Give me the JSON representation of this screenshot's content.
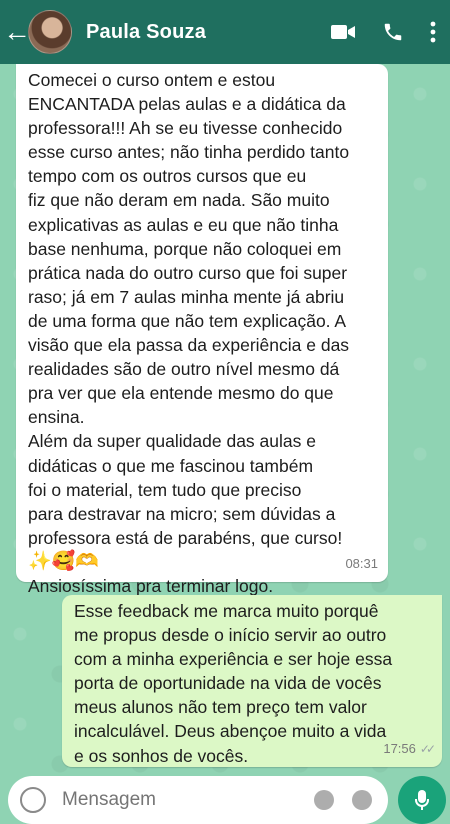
{
  "header": {
    "back_icon": "arrow-left-icon",
    "contact_name": "Paula Souza",
    "icons": [
      "video-call-icon",
      "phone-icon",
      "more-vertical-icon"
    ],
    "background_color": "#1f6f5f"
  },
  "chat": {
    "incoming": {
      "lines": [
        "Comecei o curso ontem e estou",
        "ENCANTADA pelas aulas e a didática da",
        "professora!!! Ah se eu tivesse conhecido",
        "esse curso antes; não tinha perdido tanto",
        "tempo com os outros cursos que eu",
        "fiz que não deram em nada. São muito",
        "explicativas as aulas e eu que não tinha",
        "base nenhuma, porque não coloquei em",
        "prática nada do outro curso que foi super",
        "raso; já em 7 aulas minha mente já abriu",
        "de uma forma que não tem explicação. A",
        "visão que ela passa da experiência e das",
        "realidades são de outro nível mesmo dá",
        "pra ver que ela entende mesmo do que",
        "ensina.",
        "Além da super qualidade das aulas e",
        "didáticas o que me fascinou também",
        "foi o material, tem tudo que preciso",
        "para destravar na micro; sem dúvidas a",
        "professora está de parabéns, que curso!"
      ],
      "emojis": "✨🥰🫶",
      "last_line": "Ansiosíssima pra terminar logo.",
      "time": "08:31",
      "bubble_color": "#ffffff"
    },
    "outgoing": {
      "lines": [
        "Esse feedback me marca muito porquê",
        "me propus desde o início servir ao outro",
        "com a minha experiência e ser hoje essa",
        "porta de oportunidade na vida de vocês",
        "meus alunos não tem preço tem valor",
        "incalculável. Deus abençoe muito a vida",
        "e os sonhos de vocês."
      ],
      "time": "17:56",
      "status_icon": "double-check-icon",
      "bubble_color": "#dcf8c6"
    }
  },
  "input_bar": {
    "placeholder": "Mensagem",
    "icons": [
      "emoji-icon",
      "attach-icon",
      "camera-icon",
      "mic-icon"
    ]
  },
  "colors": {
    "wallpaper": "#8fd3b3",
    "accent": "#1aa37a"
  }
}
